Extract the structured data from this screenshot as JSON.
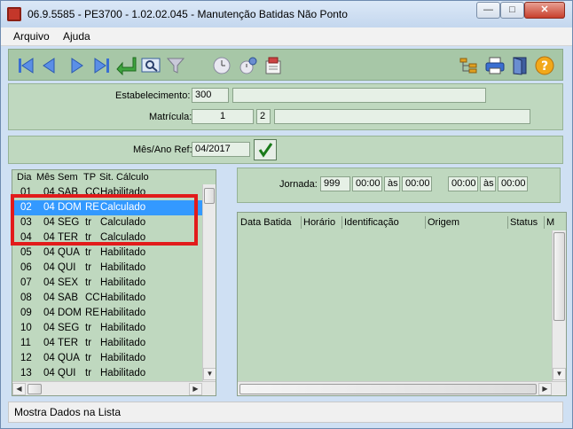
{
  "window": {
    "title": "06.9.5585 - PE3700 - 1.02.02.045 - Manutenção Batidas Não Ponto"
  },
  "menu": {
    "items": [
      {
        "label": "Arquivo"
      },
      {
        "label": "Ajuda"
      }
    ]
  },
  "header": {
    "estabelecimento_label": "Estabelecimento:",
    "estabelecimento_code": "300",
    "estabelecimento_name": "",
    "matricula_label": "Matrícula:",
    "matricula_value": "1",
    "matricula_digit": "2",
    "matricula_name": ""
  },
  "period": {
    "label": "Mês/Ano Ref:",
    "value": "04/2017"
  },
  "day_list": {
    "columns": [
      "Dia",
      "Mês",
      "Sem",
      "TP",
      "Sit. Cálculo"
    ],
    "rows": [
      {
        "dia": "01",
        "mes": "04",
        "sem": "SAB",
        "tp": "CC",
        "sit": "Habilitado"
      },
      {
        "dia": "02",
        "mes": "04",
        "sem": "DOM",
        "tp": "RE",
        "sit": "Calculado"
      },
      {
        "dia": "03",
        "mes": "04",
        "sem": "SEG",
        "tp": "tr",
        "sit": "Calculado"
      },
      {
        "dia": "04",
        "mes": "04",
        "sem": "TER",
        "tp": "tr",
        "sit": "Calculado"
      },
      {
        "dia": "05",
        "mes": "04",
        "sem": "QUA",
        "tp": "tr",
        "sit": "Habilitado"
      },
      {
        "dia": "06",
        "mes": "04",
        "sem": "QUI",
        "tp": "tr",
        "sit": "Habilitado"
      },
      {
        "dia": "07",
        "mes": "04",
        "sem": "SEX",
        "tp": "tr",
        "sit": "Habilitado"
      },
      {
        "dia": "08",
        "mes": "04",
        "sem": "SAB",
        "tp": "CC",
        "sit": "Habilitado"
      },
      {
        "dia": "09",
        "mes": "04",
        "sem": "DOM",
        "tp": "RE",
        "sit": "Habilitado"
      },
      {
        "dia": "10",
        "mes": "04",
        "sem": "SEG",
        "tp": "tr",
        "sit": "Habilitado"
      },
      {
        "dia": "11",
        "mes": "04",
        "sem": "TER",
        "tp": "tr",
        "sit": "Habilitado"
      },
      {
        "dia": "12",
        "mes": "04",
        "sem": "QUA",
        "tp": "tr",
        "sit": "Habilitado"
      },
      {
        "dia": "13",
        "mes": "04",
        "sem": "QUI",
        "tp": "tr",
        "sit": "Habilitado"
      }
    ]
  },
  "jornada": {
    "label": "Jornada:",
    "code": "999",
    "start1": "00:00",
    "sep1": "às",
    "end1": "00:00",
    "start2": "00:00",
    "sep2": "às",
    "end2": "00:00"
  },
  "batidas": {
    "columns": [
      "Data Batida",
      "Horário",
      "Identificação",
      "Origem",
      "Status",
      "M"
    ]
  },
  "status_bar": {
    "text": "Mostra Dados na Lista"
  },
  "colors": {
    "panel_green": "#bfd8bf",
    "toolbar_green": "#a7c7a7",
    "selection_blue": "#3399ff",
    "highlight_red": "#e21b1b"
  }
}
